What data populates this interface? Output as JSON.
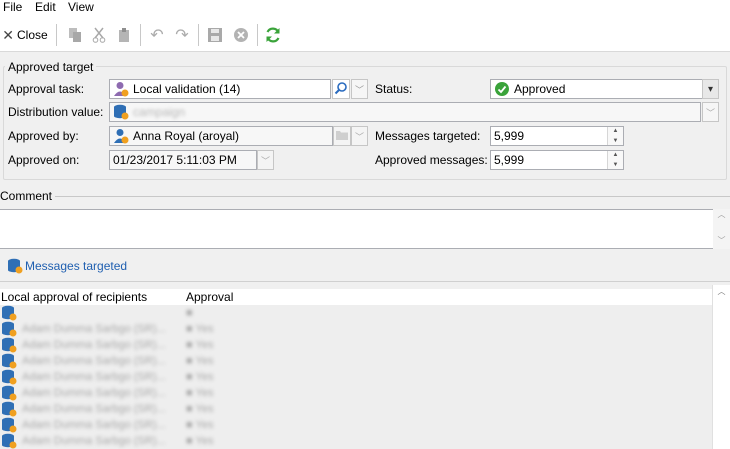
{
  "menu": {
    "file": "File",
    "edit": "Edit",
    "view": "View"
  },
  "toolbar": {
    "close_label": "Close",
    "icons": [
      "copy-icon",
      "cut-icon",
      "paste-icon",
      "undo-icon",
      "redo-icon",
      "save-icon",
      "cancel-icon",
      "refresh-icon"
    ]
  },
  "approved_target": {
    "legend": "Approved target",
    "approval_task_label": "Approval task:",
    "approval_task_value": "Local validation (14)",
    "status_label": "Status:",
    "status_value": "Approved",
    "distribution_label": "Distribution value:",
    "distribution_value": "campaign",
    "approved_by_label": "Approved by:",
    "approved_by_value": "Anna Royal (aroyal)",
    "messages_targeted_label": "Messages targeted:",
    "messages_targeted_value": "5,999",
    "approved_on_label": "Approved on:",
    "approved_on_value": "01/23/2017 5:11:03 PM",
    "approved_messages_label": "Approved messages:",
    "approved_messages_value": "5,999"
  },
  "comment": {
    "legend": "Comment",
    "value": ""
  },
  "messages_link": "Messages targeted",
  "list": {
    "col_name": "Local approval of recipients",
    "col_approval": "Approval",
    "rows": [
      {
        "name": "",
        "approval": ""
      },
      {
        "name": "Adam Dumma Sarbgo (SR)...",
        "approval": "Yes"
      },
      {
        "name": "Adam Dumma Sarbgo (SR)...",
        "approval": "Yes"
      },
      {
        "name": "Adam Dumma Sarbgo (SR)...",
        "approval": "Yes"
      },
      {
        "name": "Adam Dumma Sarbgo (SR)...",
        "approval": "Yes"
      },
      {
        "name": "Adam Dumma Sarbgo (SR)...",
        "approval": "Yes"
      },
      {
        "name": "Adam Dumma Sarbgo (SR)...",
        "approval": "Yes"
      },
      {
        "name": "Adam Dumma Sarbgo (SR)...",
        "approval": "Yes"
      },
      {
        "name": "Adam Dumma Sarbgo (SR)...",
        "approval": "Yes"
      }
    ]
  }
}
